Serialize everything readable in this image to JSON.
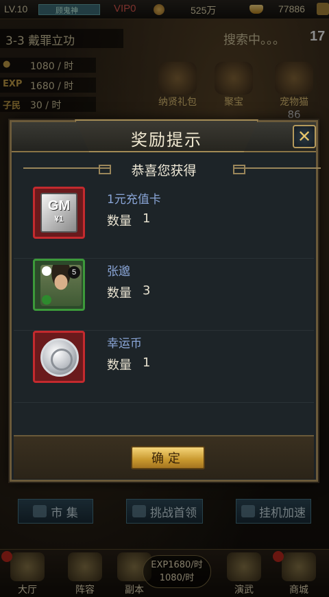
{
  "top_bar": {
    "level": "LV.10",
    "title": "顾鬼神",
    "vip": "VIP0",
    "copper": "525万",
    "gold": "77886"
  },
  "stage": {
    "name": "3-3 戴罪立功",
    "search": "搜索中。。。",
    "search_count": "17"
  },
  "stats": [
    {
      "key": "",
      "value": "1080 / 时"
    },
    {
      "key": "EXP",
      "value": "1680 / 时"
    },
    {
      "key": "子民",
      "value": "30 / 时"
    }
  ],
  "buildings": [
    {
      "label": "纳贤礼包",
      "icon": "gift-icon",
      "count": ""
    },
    {
      "label": "聚宝",
      "icon": "treasure-pot-icon",
      "count": ""
    },
    {
      "label": "宠物猫",
      "icon": "pet-icon",
      "count": "86"
    }
  ],
  "dialog": {
    "title": "奖励提示",
    "congrats": "恭喜您获得",
    "close_icon": "close-icon",
    "confirm_label": "确定",
    "qty_label": "数量",
    "rewards": [
      {
        "name": "1元充值卡",
        "quantity": "1",
        "icon": "gm-card-icon",
        "card_text": "GM",
        "card_value": "¥1"
      },
      {
        "name": "张邈",
        "quantity": "3",
        "icon": "hero-portrait-icon",
        "star": "5"
      },
      {
        "name": "幸运币",
        "quantity": "1",
        "icon": "lucky-coin-icon"
      }
    ]
  },
  "middle_buttons": [
    {
      "label": "市 集",
      "icon": "market-icon"
    },
    {
      "label": "挑战首领",
      "icon": "crossed-swords-icon"
    },
    {
      "label": "挂机加速",
      "icon": "wing-icon"
    }
  ],
  "bottom_nav": {
    "items": [
      {
        "label": "大厅",
        "icon": "hall-icon"
      },
      {
        "label": "阵容",
        "icon": "formation-icon"
      },
      {
        "label": "副本",
        "icon": "dungeon-icon"
      },
      {
        "label": "演武",
        "icon": "arena-icon"
      },
      {
        "label": "商城",
        "icon": "shop-icon"
      }
    ],
    "exp_rate": "EXP1680/时",
    "copper_rate": "1080/时"
  },
  "colors": {
    "accent_gold": "#c8982e",
    "reward_name": "#8aa6d8",
    "rare_border": "#c42a2e",
    "hero_border": "#3c9a3a"
  }
}
